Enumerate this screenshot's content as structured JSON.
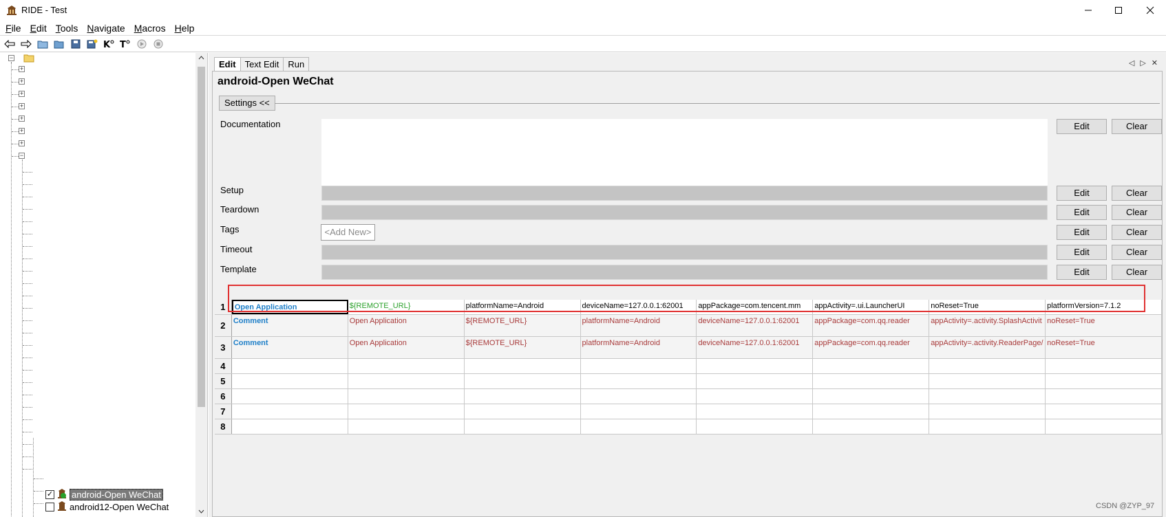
{
  "window": {
    "title": "RIDE - Test"
  },
  "menu": [
    {
      "underline": "F",
      "rest": "ile"
    },
    {
      "underline": "E",
      "rest": "dit"
    },
    {
      "underline": "T",
      "rest": "ools"
    },
    {
      "underline": "N",
      "rest": "avigate"
    },
    {
      "underline": "M",
      "rest": "acros"
    },
    {
      "underline": "H",
      "rest": "elp"
    }
  ],
  "tree": {
    "items": [
      {
        "label": "android-Open WeChat",
        "checked": true,
        "selected": true
      },
      {
        "label": "android12-Open WeChat",
        "checked": false,
        "selected": false
      }
    ],
    "check_mark": "✓"
  },
  "tabs": [
    "Edit",
    "Text Edit",
    "Run"
  ],
  "editor": {
    "title": "android-Open WeChat",
    "settings_label": "Settings <<",
    "fields": [
      "Documentation",
      "Setup",
      "Teardown",
      "Tags",
      "Timeout",
      "Template"
    ],
    "add_new": "<Add New>",
    "edit_label": "Edit",
    "clear_label": "Clear"
  },
  "grid": {
    "row_numbers": [
      "1",
      "2",
      "3",
      "4",
      "5",
      "6",
      "7",
      "8"
    ],
    "rows": [
      [
        "Open Application",
        "${REMOTE_URL}",
        "platformName=Android",
        "deviceName=127.0.0.1:62001",
        "appPackage=com.tencent.mm",
        "appActivity=.ui.LauncherUI",
        "noReset=True",
        "platformVersion=7.1.2"
      ],
      [
        "Comment",
        "Open Application",
        "${REMOTE_URL}",
        "platformName=Android",
        "deviceName=127.0.0.1:62001",
        "appPackage=com.qq.reader",
        "appActivity=.activity.SplashActivit",
        "noReset=True"
      ],
      [
        "Comment",
        "Open Application",
        "${REMOTE_URL}",
        "platformName=Android",
        "deviceName=127.0.0.1:62001",
        "appPackage=com.qq.reader",
        "appActivity=.activity.ReaderPage/",
        "noReset=True"
      ]
    ]
  },
  "watermark": "CSDN @ZYP_97",
  "colors": {
    "keyword": "#1e7fc8",
    "variable": "#2aa02a",
    "comment_text": "#a83a3a",
    "highlight_box": "#e03030"
  }
}
